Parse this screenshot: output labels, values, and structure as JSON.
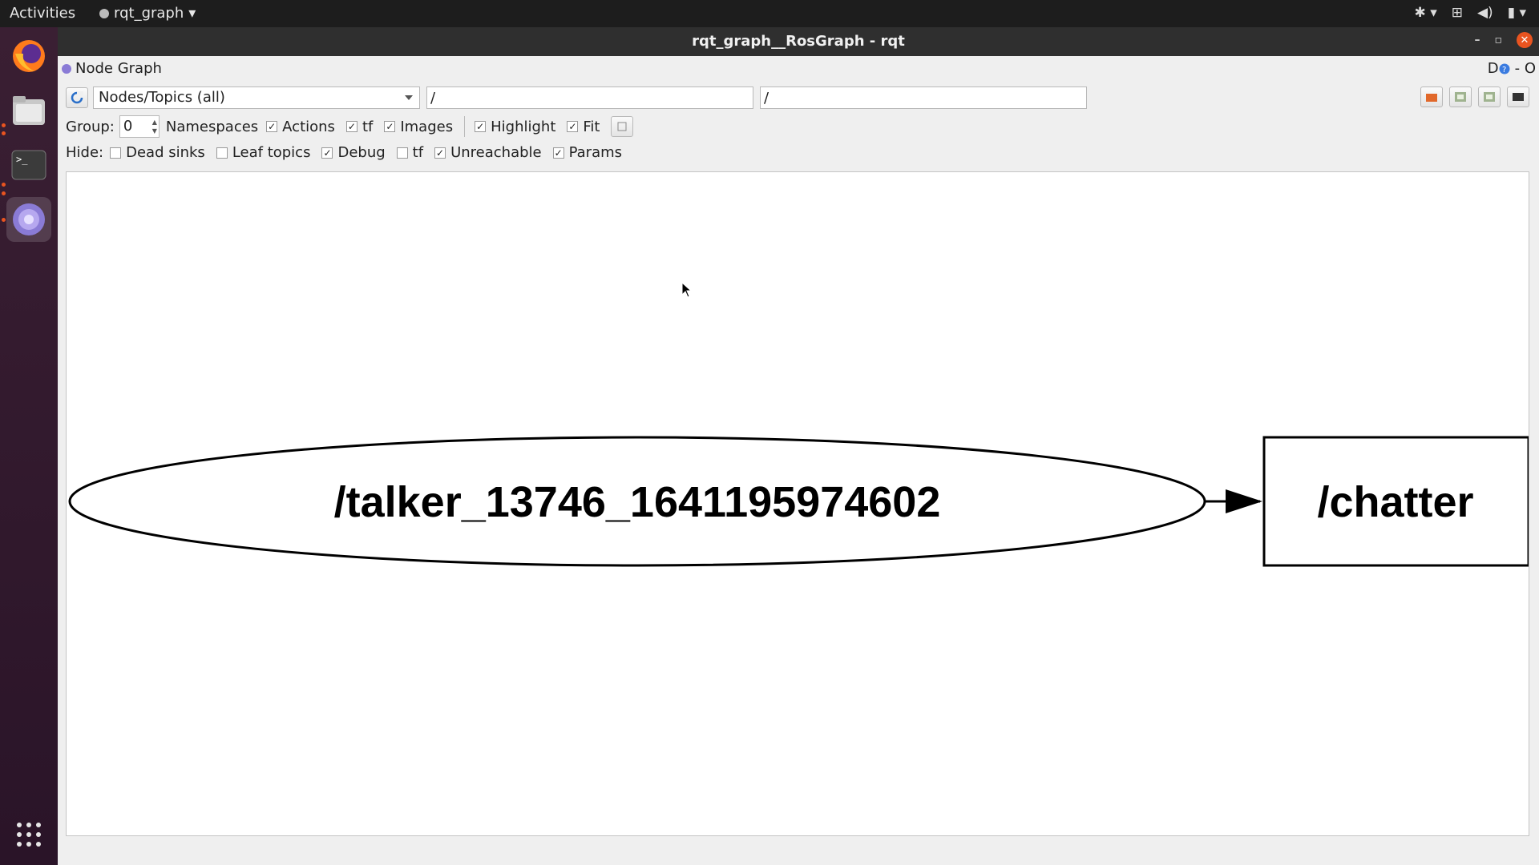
{
  "topbar": {
    "activities": "Activities",
    "app_menu": "rqt_graph"
  },
  "dock": {
    "items": [
      "firefox",
      "files",
      "terminal",
      "rqt"
    ]
  },
  "window": {
    "title": "rqt_graph__RosGraph - rqt"
  },
  "plugin": {
    "title": "Node Graph",
    "right_label": "D",
    "right_controls": "- O"
  },
  "toolbar": {
    "graph_mode": "Nodes/Topics (all)",
    "node_filter": "/",
    "topic_filter": "/"
  },
  "options": {
    "group_label": "Group:",
    "group_value": "0",
    "namespaces": "Namespaces",
    "actions": {
      "label": "Actions",
      "checked": true
    },
    "tf": {
      "label": "tf",
      "checked": true
    },
    "images": {
      "label": "Images",
      "checked": true
    },
    "highlight": {
      "label": "Highlight",
      "checked": true
    },
    "fit": {
      "label": "Fit",
      "checked": true
    }
  },
  "hide": {
    "label": "Hide:",
    "dead_sinks": {
      "label": "Dead sinks",
      "checked": false
    },
    "leaf_topics": {
      "label": "Leaf topics",
      "checked": false
    },
    "debug": {
      "label": "Debug",
      "checked": true
    },
    "tf": {
      "label": "tf",
      "checked": false
    },
    "unreachable": {
      "label": "Unreachable",
      "checked": true
    },
    "params": {
      "label": "Params",
      "checked": true
    }
  },
  "graph": {
    "node_label": "/talker_13746_1641195974602",
    "topic_label": "/chatter"
  }
}
